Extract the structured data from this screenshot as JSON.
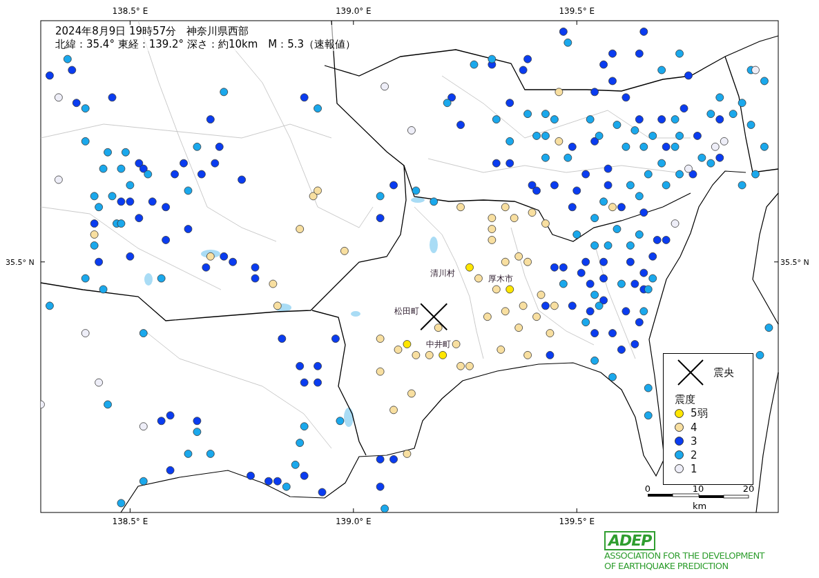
{
  "header": {
    "title": "2024年8月9日 19時57分　神奈川県西部",
    "details": "北緯：35.4° 東経：139.2° 深さ：約10km　M：5.3（速報値）"
  },
  "map": {
    "lon_labels_top": [
      "138.5° E",
      "139.0° E",
      "139.5° E"
    ],
    "lon_labels_bottom": [
      "138.5° E",
      "139.0° E",
      "139.5° E"
    ],
    "lat_labels": [
      "35.5° N",
      "35.5° N"
    ],
    "place_labels": [
      "清川村",
      "厚木市",
      "松田町",
      "中井町"
    ],
    "legend": {
      "epicenter_label": "震央",
      "intensity_title": "震度",
      "classes": [
        {
          "name": "5弱",
          "color": "#ffe600"
        },
        {
          "name": "4",
          "color": "#f8dfa0"
        },
        {
          "name": "3",
          "color": "#0a3cf0"
        },
        {
          "name": "2",
          "color": "#1aa8ec"
        },
        {
          "name": "1",
          "color": "#eeeef8"
        }
      ]
    },
    "scale_bar": {
      "labels": [
        "0",
        "10",
        "20"
      ],
      "unit": "km"
    }
  },
  "logo": {
    "mark": "ADEP",
    "lines": [
      "ASSOCIATION FOR THE DEVELOPMENT",
      "OF EARTHQUAKE PREDICTION"
    ]
  }
}
